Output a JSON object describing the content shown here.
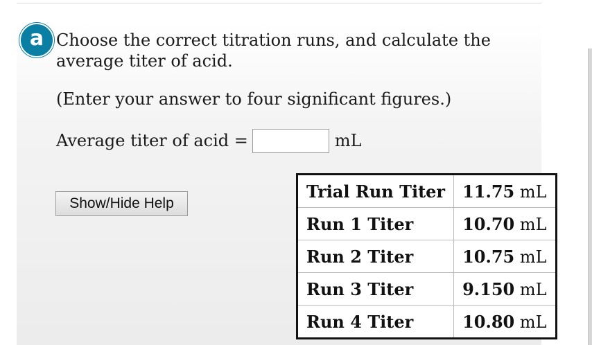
{
  "question": {
    "badge": "a",
    "prompt": "Choose the correct titration runs, and calculate the average titer of acid.",
    "hint": "(Enter your answer to four significant figures.)"
  },
  "answer": {
    "label": "Average titer of acid =",
    "value": "",
    "unit": "mL"
  },
  "help_button": {
    "label": "Show/Hide Help"
  },
  "titer_table": {
    "rows": [
      {
        "label": "Trial Run Titer",
        "value": "11.75",
        "unit": "mL"
      },
      {
        "label": "Run 1 Titer",
        "value": "10.70",
        "unit": "mL"
      },
      {
        "label": "Run 2 Titer",
        "value": "10.75",
        "unit": "mL"
      },
      {
        "label": "Run 3 Titer",
        "value": "9.150",
        "unit": "mL"
      },
      {
        "label": "Run 4 Titer",
        "value": "10.80",
        "unit": "mL"
      }
    ]
  },
  "colors": {
    "badge": "#0a7fa3",
    "table_border": "#111111"
  }
}
